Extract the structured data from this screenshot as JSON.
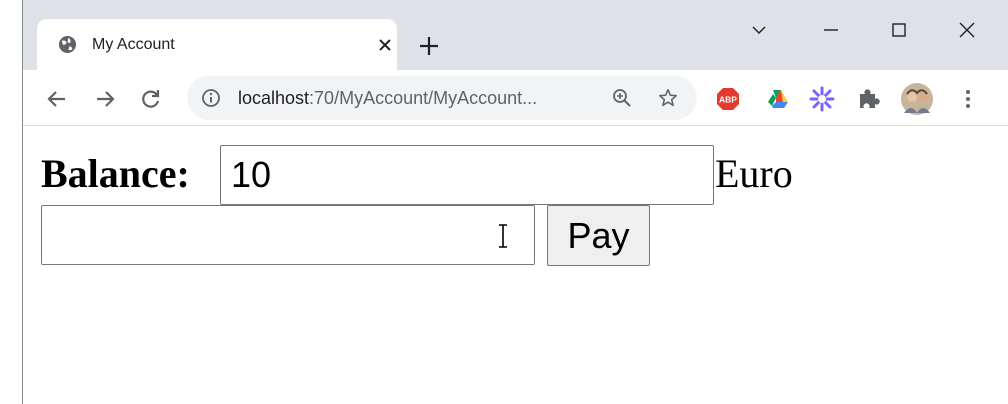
{
  "browser": {
    "tab": {
      "title": "My Account",
      "favicon": "globe-icon"
    },
    "new_tab_icon": "plus-icon",
    "window_controls": [
      "chevron-down-icon",
      "minimize-icon",
      "maximize-icon",
      "close-icon"
    ],
    "address": {
      "host": "localhost",
      "rest": ":70/MyAccount/MyAccount..."
    },
    "extensions": [
      "adblock-plus-icon",
      "google-drive-icon",
      "extension-flower-icon",
      "puzzle-icon",
      "profile-avatar",
      "menu-icon"
    ]
  },
  "page": {
    "balance_label": "Balance:",
    "balance_value": "10",
    "currency": "Euro",
    "pay_amount": "",
    "pay_button": "Pay"
  },
  "colors": {
    "tabstrip": "#dee1e6",
    "omnibox": "#f1f3f4",
    "abp_red": "#e33b2e"
  }
}
